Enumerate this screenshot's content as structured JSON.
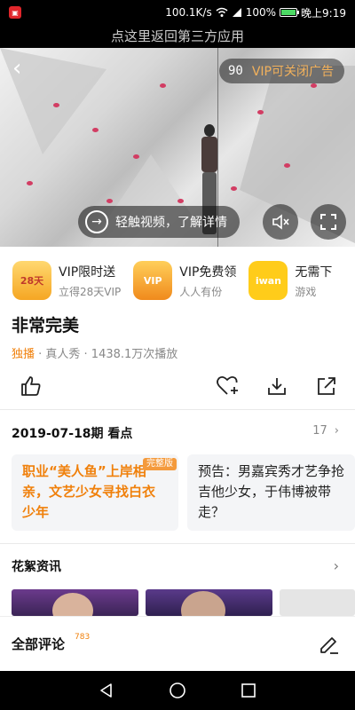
{
  "status_bar": {
    "speed": "100.1K/s",
    "battery": "100%",
    "battery_level": 1.0,
    "time": "晚上9:19"
  },
  "back_to_app": "点这里返回第三方应用",
  "video": {
    "ad_countdown": "90",
    "vip_close_ad": "VIP可关闭广告",
    "learn_more": "轻触视频，了解详情"
  },
  "promos": [
    {
      "title": "VIP限时送",
      "subtitle": "立得28天VIP",
      "icon_text": "28天"
    },
    {
      "title": "VIP免费领",
      "subtitle": "人人有份",
      "icon_text": "VIP"
    },
    {
      "title": "无需下",
      "subtitle": "游戏",
      "icon_text": "iwan"
    }
  ],
  "show": {
    "title": "非常完美",
    "exclusive": "独播",
    "meta_rest": " · 真人秀 · 1438.1万次播放"
  },
  "episodes": {
    "header": "2019-07-18期 看点",
    "count": "17",
    "cards": [
      {
        "text": "职业“美人鱼”上岸相亲，文艺少女寻找白衣少年",
        "tag": "完整版"
      },
      {
        "text": "预告：男嘉宾秀才艺争抢吉他少女，于伟博被带走？"
      }
    ]
  },
  "highlights": {
    "header": "花絮资讯"
  },
  "comments": {
    "label": "全部评论",
    "count": "783"
  },
  "colors": {
    "accent": "#f0800b",
    "vip_gold": "#f2b15c"
  }
}
